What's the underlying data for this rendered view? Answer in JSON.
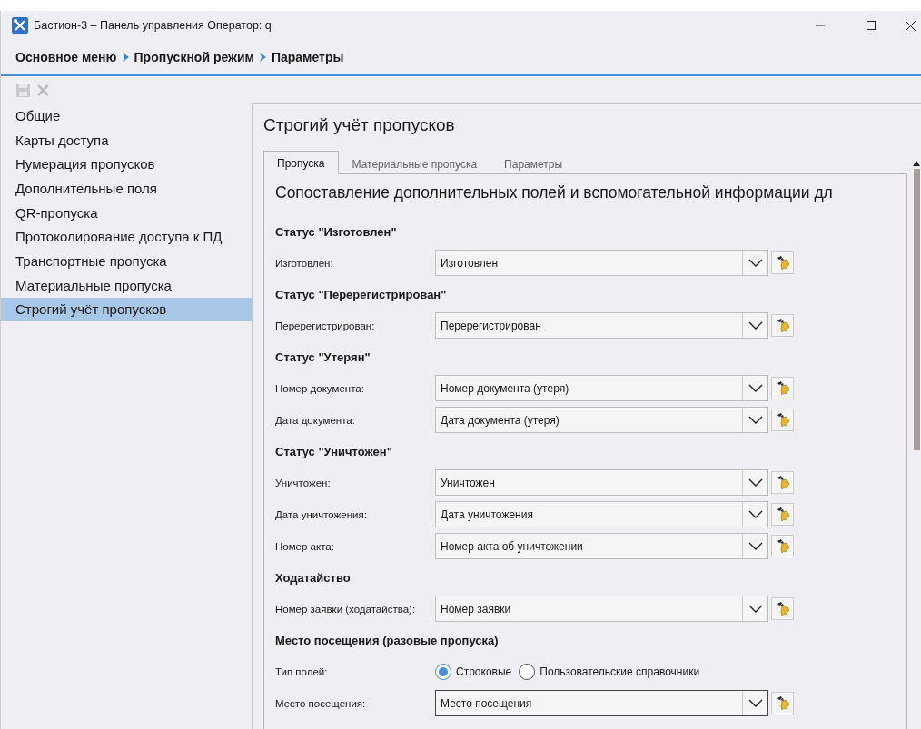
{
  "window": {
    "title": "Бастион-3 – Панель управления Оператор: q"
  },
  "breadcrumb": [
    "Основное меню",
    "Пропускной режим",
    "Параметры"
  ],
  "sidebar": {
    "items": [
      {
        "label": "Общие",
        "selected": false
      },
      {
        "label": "Карты доступа",
        "selected": false
      },
      {
        "label": "Нумерация пропусков",
        "selected": false
      },
      {
        "label": "Дополнительные поля",
        "selected": false
      },
      {
        "label": "QR-пропуска",
        "selected": false
      },
      {
        "label": "Протоколирование доступа к ПД",
        "selected": false
      },
      {
        "label": "Транспортные пропуска",
        "selected": false
      },
      {
        "label": "Материальные пропуска",
        "selected": false
      },
      {
        "label": "Строгий учёт пропусков",
        "selected": true
      }
    ]
  },
  "panel": {
    "title": "Строгий учёт пропусков",
    "tabs": [
      {
        "label": "Пропуска",
        "selected": true
      },
      {
        "label": "Материальные пропуска",
        "selected": false
      },
      {
        "label": "Параметры",
        "selected": false
      }
    ],
    "heading": "Сопоставление дополнительных полей и вспомогательной информации дл",
    "sections": [
      {
        "heading": "Статус \"Изготовлен\"",
        "rows": [
          {
            "kind": "combo",
            "label": "Изготовлен:",
            "value": "Изготовлен",
            "focused": false
          }
        ]
      },
      {
        "heading": "Статус \"Перерегистрирован\"",
        "rows": [
          {
            "kind": "combo",
            "label": "Перерегистрирован:",
            "value": "Перерегистрирован",
            "focused": false
          }
        ]
      },
      {
        "heading": "Статус \"Утерян\"",
        "rows": [
          {
            "kind": "combo",
            "label": "Номер документа:",
            "value": "Номер документа (утеря)",
            "focused": false
          },
          {
            "kind": "combo",
            "label": "Дата документа:",
            "value": "Дата документа (утеря)",
            "focused": false
          }
        ]
      },
      {
        "heading": "Статус \"Уничтожен\"",
        "rows": [
          {
            "kind": "combo",
            "label": "Уничтожен:",
            "value": "Уничтожен",
            "focused": false
          },
          {
            "kind": "combo",
            "label": "Дата уничтожения:",
            "value": "Дата уничтожения",
            "focused": false
          },
          {
            "kind": "combo",
            "label": "Номер акта:",
            "value": "Номер акта об уничтожении",
            "focused": false
          }
        ]
      },
      {
        "heading": "Ходатайство",
        "rows": [
          {
            "kind": "combo",
            "label": "Номер заявки (ходатайства):",
            "value": "Номер заявки",
            "focused": false
          }
        ]
      },
      {
        "heading": "Место посещения (разовые пропуска)",
        "rows": [
          {
            "kind": "radio",
            "label": "Тип полей:",
            "options": [
              {
                "label": "Строковые",
                "selected": true
              },
              {
                "label": "Пользовательские справочники",
                "selected": false
              }
            ]
          },
          {
            "kind": "combo",
            "label": "Место посещения:",
            "value": "Место посещения",
            "focused": true
          }
        ]
      }
    ]
  }
}
